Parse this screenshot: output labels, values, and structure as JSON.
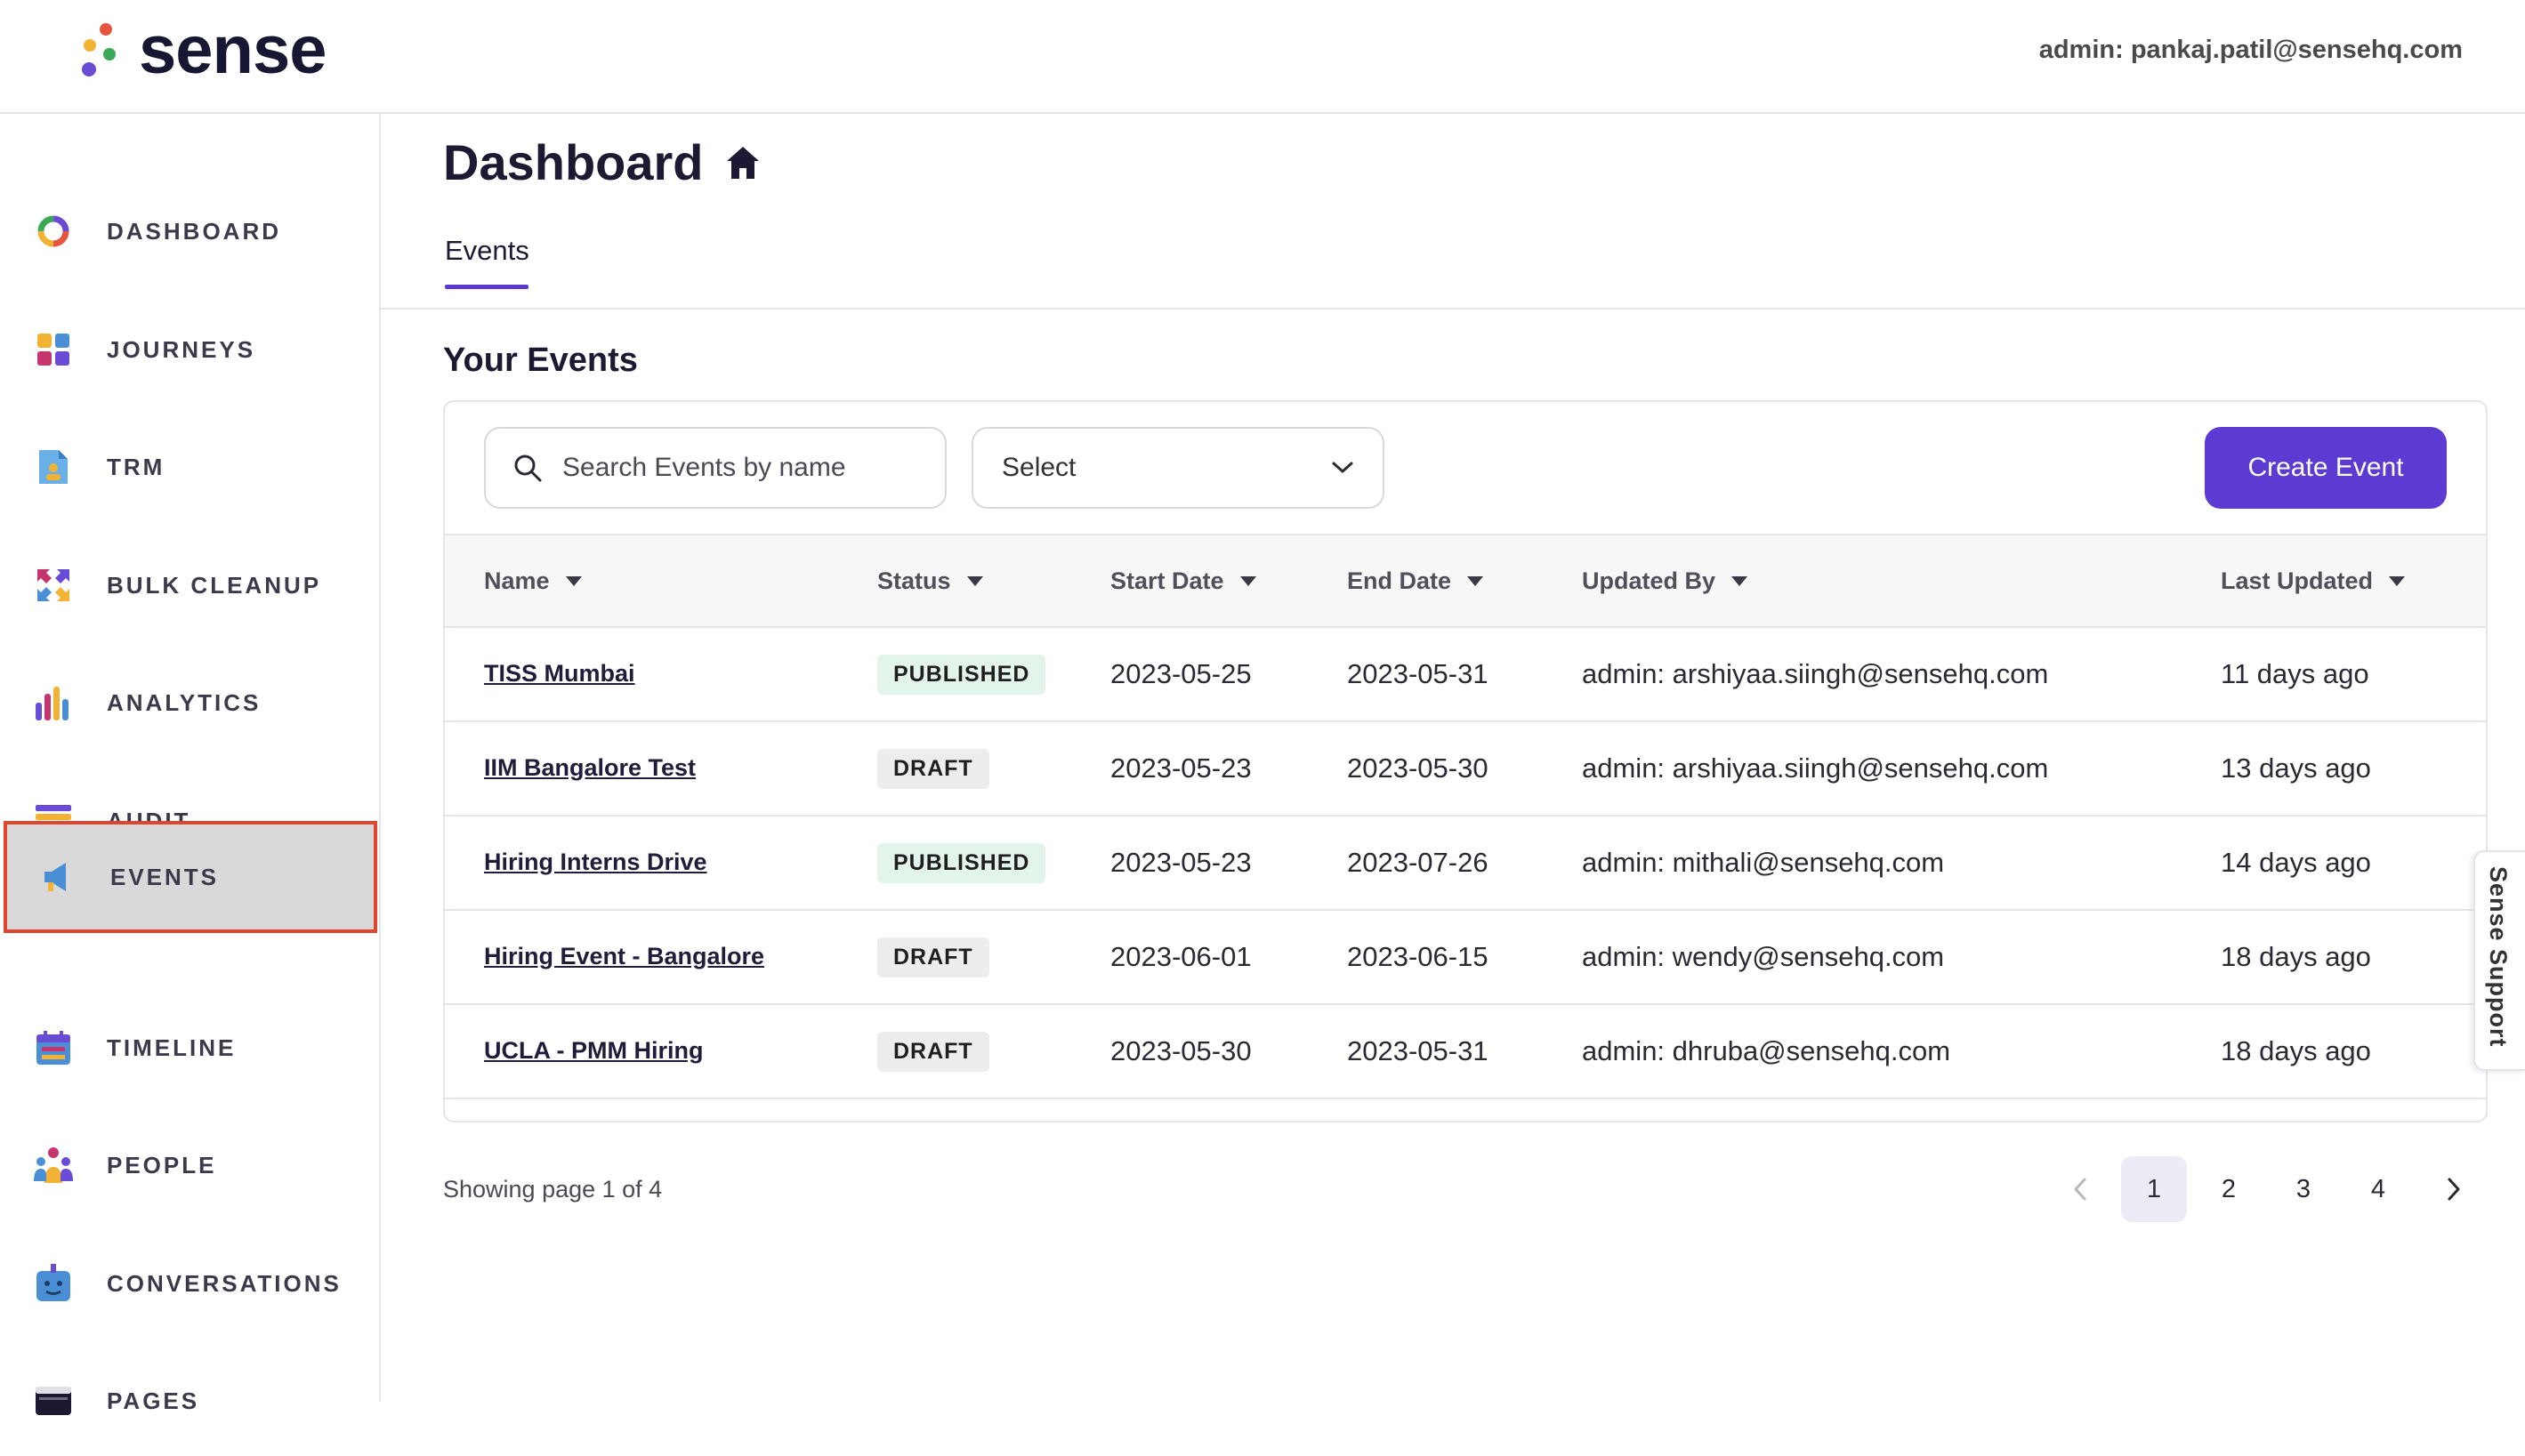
{
  "brand": {
    "name": "sense"
  },
  "header": {
    "admin_label": "admin: pankaj.patil@sensehq.com"
  },
  "sidebar": {
    "items": [
      {
        "label": "DASHBOARD",
        "icon": "dashboard-ring-icon"
      },
      {
        "label": "JOURNEYS",
        "icon": "journeys-grid-icon"
      },
      {
        "label": "TRM",
        "icon": "trm-document-icon"
      },
      {
        "label": "BULK CLEANUP",
        "icon": "bulk-cleanup-arrows-icon"
      },
      {
        "label": "ANALYTICS",
        "icon": "analytics-bars-icon"
      },
      {
        "label": "AUDIT",
        "icon": "audit-list-icon"
      },
      {
        "label": "EVENTS",
        "icon": "megaphone-icon",
        "active": true
      },
      {
        "label": "TIMELINE",
        "icon": "calendar-icon"
      },
      {
        "label": "PEOPLE",
        "icon": "people-icon"
      },
      {
        "label": "CONVERSATIONS",
        "icon": "chatbot-icon"
      },
      {
        "label": "PAGES",
        "icon": "browser-page-icon"
      }
    ]
  },
  "main": {
    "title": "Dashboard",
    "tabs": [
      {
        "label": "Events",
        "active": true
      }
    ],
    "section_title": "Your Events",
    "search": {
      "placeholder": "Search Events by name"
    },
    "select": {
      "value": "Select"
    },
    "create_button": "Create Event",
    "table": {
      "headers": [
        "Name",
        "Status",
        "Start Date",
        "End Date",
        "Updated By",
        "Last Updated"
      ],
      "rows": [
        {
          "name": "TISS Mumbai",
          "status": "PUBLISHED",
          "start": "2023-05-25",
          "end": "2023-05-31",
          "updated_by": "admin: arshiyaa.siingh@sensehq.com",
          "last_updated": "11 days ago"
        },
        {
          "name": "IIM Bangalore Test",
          "status": "DRAFT",
          "start": "2023-05-23",
          "end": "2023-05-30",
          "updated_by": "admin: arshiyaa.siingh@sensehq.com",
          "last_updated": "13 days ago"
        },
        {
          "name": "Hiring Interns Drive",
          "status": "PUBLISHED",
          "start": "2023-05-23",
          "end": "2023-07-26",
          "updated_by": "admin: mithali@sensehq.com",
          "last_updated": "14 days ago"
        },
        {
          "name": "Hiring Event - Bangalore",
          "status": "DRAFT",
          "start": "2023-06-01",
          "end": "2023-06-15",
          "updated_by": "admin: wendy@sensehq.com",
          "last_updated": "18 days ago"
        },
        {
          "name": "UCLA - PMM Hiring",
          "status": "DRAFT",
          "start": "2023-05-30",
          "end": "2023-05-31",
          "updated_by": "admin: dhruba@sensehq.com",
          "last_updated": "18 days ago"
        }
      ]
    },
    "pagination": {
      "text": "Showing page 1 of 4",
      "pages": [
        "1",
        "2",
        "3",
        "4"
      ],
      "current": "1"
    }
  },
  "support_tab": "Sense Support",
  "colors": {
    "accent": "#5b3bd1",
    "active_outline": "#e0452e",
    "published_bg": "#e3f4ea",
    "draft_bg": "#ededed"
  }
}
